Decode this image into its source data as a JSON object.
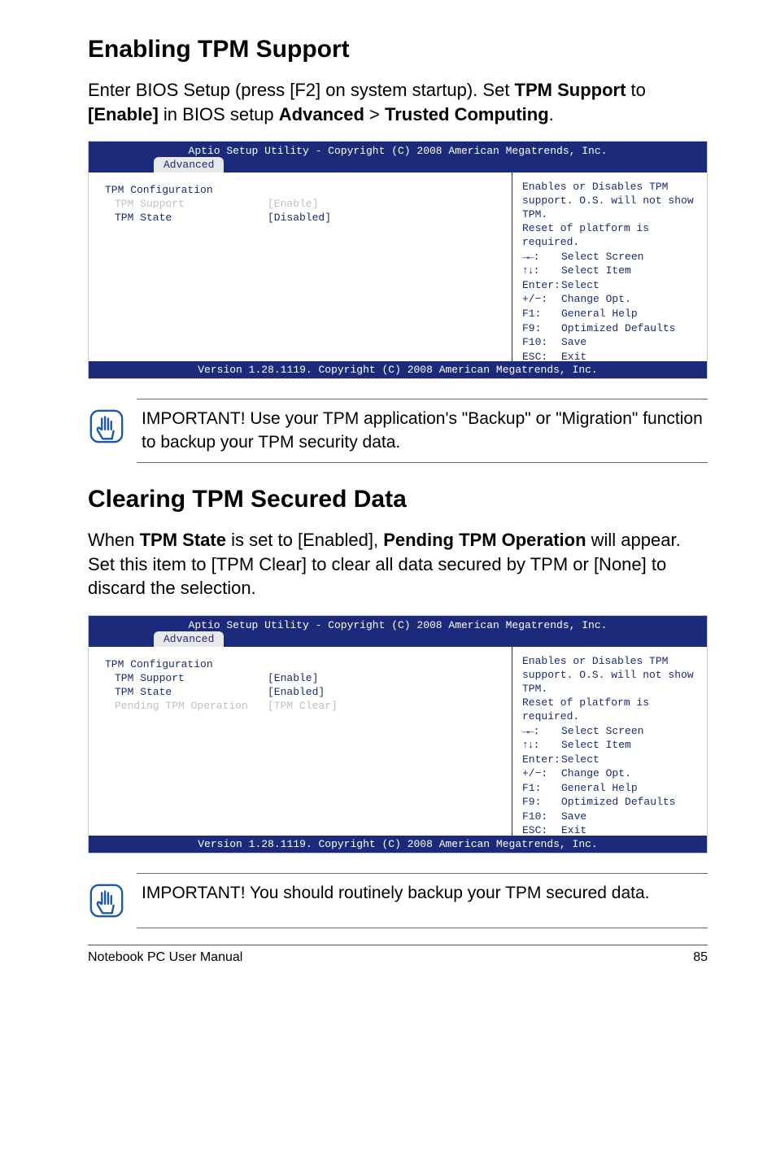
{
  "section1": {
    "heading": "Enabling TPM Support",
    "intro_pre": "Enter BIOS Setup (press [F2] on system startup). Set ",
    "intro_b1": "TPM Support",
    "intro_mid1": " to ",
    "intro_b2": "[Enable]",
    "intro_mid2": " in BIOS setup ",
    "intro_b3": "Advanced",
    "intro_gt": " > ",
    "intro_b4": "Trusted Computing",
    "intro_end": "."
  },
  "bios": {
    "title": "Aptio Setup Utility - Copyright (C) 2008 American Megatrends, Inc.",
    "tab": "Advanced",
    "config_title": "TPM Configuration",
    "rows1": {
      "support_label": "TPM Support",
      "support_value": "[Enable]",
      "state_label": "TPM State",
      "state_value": "[Disabled]"
    },
    "rows2": {
      "support_label": "TPM Support",
      "support_value": "[Enable]",
      "state_label": "TPM State",
      "state_value": "[Enabled]",
      "pending_label": "Pending TPM Operation",
      "pending_value": "[TPM Clear]"
    },
    "help": {
      "l1": "Enables or Disables TPM",
      "l2": "support. O.S. will not show TPM.",
      "l3": "Reset of platform is required."
    },
    "keys": {
      "arrows_lr": "→←:",
      "arrows_lr_v": "Select Screen",
      "arrows_ud": "↑↓:",
      "arrows_ud_v": "Select Item",
      "enter": "Enter:",
      "enter_v": " Select",
      "pm": "+/−:",
      "pm_v": "Change Opt.",
      "f1": "F1:",
      "f1_v": "General Help",
      "f9": "F9:",
      "f9_v": "Optimized Defaults",
      "f10": "F10:",
      "f10_v": "Save",
      "esc": "ESC:",
      "esc_v": "Exit"
    },
    "footer": "Version 1.28.1119. Copyright (C) 2008 American Megatrends, Inc."
  },
  "note1": "IMPORTANT! Use your TPM application's \"Backup\" or \"Migration\" function to backup your TPM security data.",
  "section2": {
    "heading": "Clearing TPM Secured Data",
    "intro_pre": "When ",
    "intro_b1": "TPM State",
    "intro_mid1": " is set to [Enabled], ",
    "intro_b2": "Pending TPM Operation",
    "intro_mid2": " will appear. Set this item to [TPM Clear] to clear all data secured by TPM or [None] to discard the selection."
  },
  "note2": "IMPORTANT! You should routinely backup your TPM secured data.",
  "footer": {
    "left": "Notebook PC User Manual",
    "right": "85"
  }
}
